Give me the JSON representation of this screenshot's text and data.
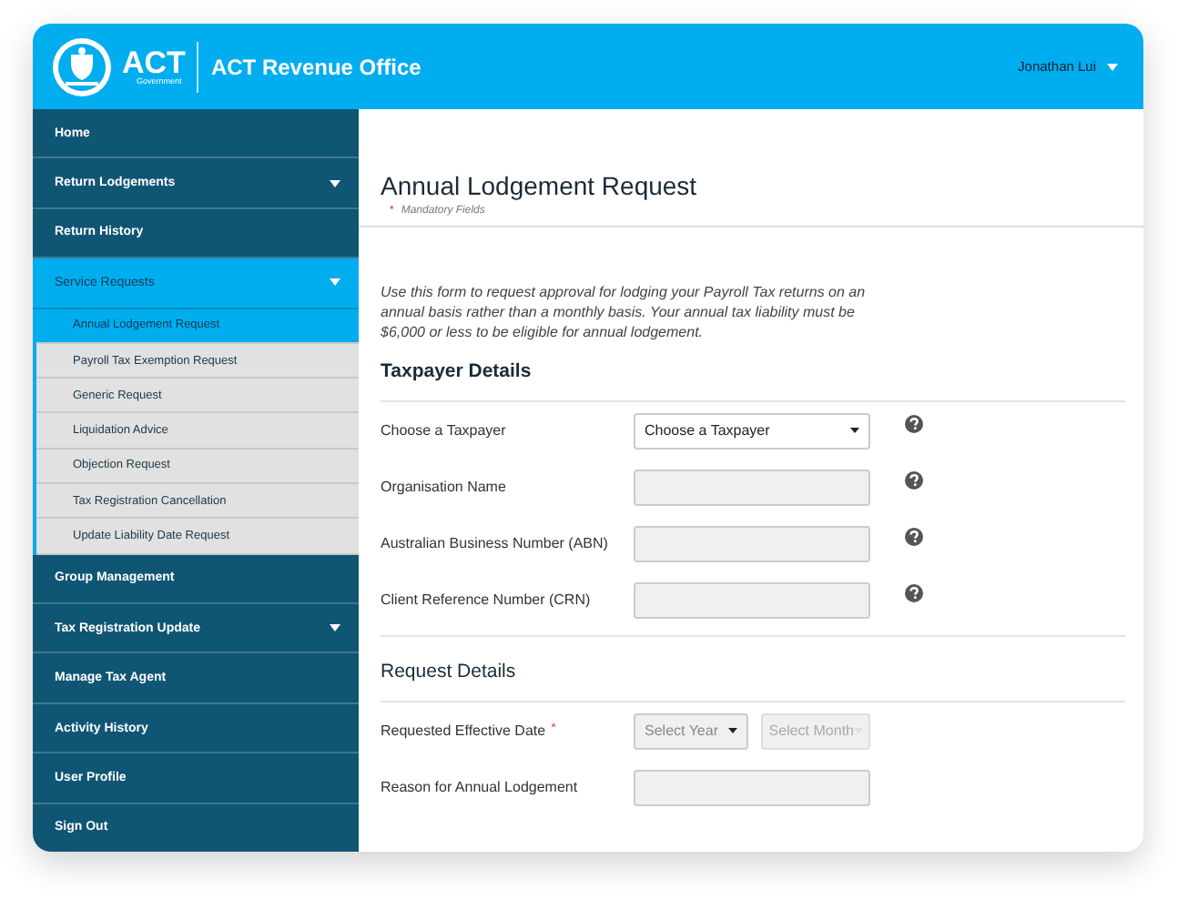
{
  "header": {
    "logo": {
      "mark": "ACT",
      "subtitle": "Government"
    },
    "title": "ACT Revenue Office",
    "user": "Jonathan Lui"
  },
  "nav": {
    "items": [
      {
        "label": "Home",
        "selected": false,
        "has_submenu": false
      },
      {
        "label": "Return Lodgements",
        "selected": false,
        "has_submenu": true
      },
      {
        "label": "Return History",
        "selected": false,
        "has_submenu": false
      },
      {
        "label": "Service Requests",
        "selected": true,
        "has_submenu": true,
        "children": [
          {
            "label": "Annual Lodgement Request",
            "selected": true
          },
          {
            "label": "Payroll Tax Exemption Request",
            "selected": false
          },
          {
            "label": "Generic Request",
            "selected": false
          },
          {
            "label": "Liquidation Advice",
            "selected": false
          },
          {
            "label": "Objection Request",
            "selected": false
          },
          {
            "label": "Tax Registration Cancellation",
            "selected": false
          },
          {
            "label": "Update Liability Date Request",
            "selected": false
          }
        ]
      },
      {
        "label": "Group Management",
        "selected": false,
        "has_submenu": false
      },
      {
        "label": "Tax Registration Update",
        "selected": false,
        "has_submenu": true
      },
      {
        "label": "Manage Tax Agent",
        "selected": false,
        "has_submenu": false
      },
      {
        "label": "Activity History",
        "selected": false,
        "has_submenu": false
      },
      {
        "label": "User Profile",
        "selected": false,
        "has_submenu": false
      },
      {
        "label": "Sign Out",
        "selected": false,
        "has_submenu": false
      }
    ]
  },
  "form": {
    "title": "Annual Lodgement Request",
    "mandatory_note": {
      "marker": "*",
      "text": "Mandatory Fields"
    },
    "intro": "Use this form to request approval for lodging your Payroll Tax returns on an annual basis rather than a monthly basis. Your annual tax liability must be $6,000 or less to be eligible for annual lodgement.",
    "sections": [
      {
        "title": "Taxpayer Details",
        "fields": [
          {
            "label": "Choose a Taxpayer",
            "help": true,
            "controls": [
              {
                "kind": "select",
                "value": "Choose a Taxpayer",
                "disabled": false
              }
            ]
          },
          {
            "label": "Organisation Name",
            "help": true,
            "controls": [
              {
                "kind": "text",
                "disabled": true
              }
            ]
          },
          {
            "label": "Australian Business Number (ABN)",
            "help": true,
            "controls": [
              {
                "kind": "text",
                "disabled": true
              }
            ]
          },
          {
            "label": "Client Reference Number (CRN)",
            "help": true,
            "controls": [
              {
                "kind": "text",
                "disabled": true
              }
            ]
          }
        ]
      },
      {
        "title": "Request Details",
        "fields": [
          {
            "label": "Requested Effective Date",
            "required_mark": "*",
            "help": false,
            "controls": [
              {
                "kind": "select",
                "placeholder": "Select Year",
                "disabled": false
              },
              {
                "kind": "select",
                "placeholder": "Select Month",
                "disabled": true
              }
            ]
          },
          {
            "label": "Reason for Annual Lodgement",
            "help": false,
            "controls": [
              {
                "kind": "text",
                "disabled": true
              }
            ]
          }
        ]
      }
    ]
  }
}
